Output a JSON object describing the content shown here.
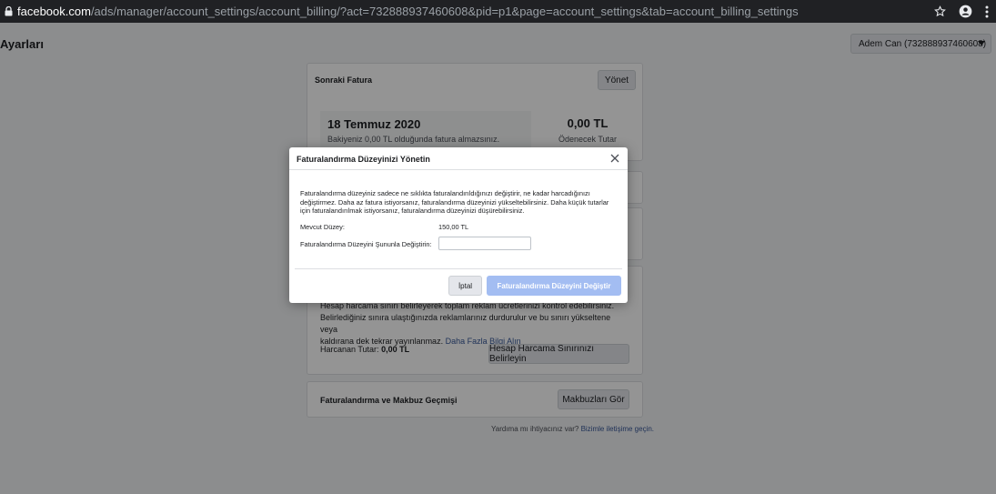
{
  "browser": {
    "url_domain": "facebook.com",
    "url_path": "/ads/manager/account_settings/account_billing/?act=732888937460608&pid=p1&page=account_settings&tab=account_billing_settings"
  },
  "header": {
    "title": "Ayarları",
    "account_selector": "Adem Can (732888937460608)"
  },
  "next_invoice": {
    "title": "Sonraki Fatura",
    "manage_button": "Yönet",
    "date": "18 Temmuz 2020",
    "note": "Bakiyeniz 0,00 TL olduğunda fatura almazsınız.",
    "amount": "0,00 TL",
    "amount_label": "Ödenecek Tutar"
  },
  "spending_limit": {
    "text_line1": "Hesap harcama sınırı belirleyerek toplam reklam ücretlerinizi kontrol edebilirsiniz.",
    "text_line2": "Belirlediğiniz sınıra ulaştığınızda reklamlarınız durdurulur ve bu sınırı yükseltene veya",
    "text_line3": "kaldırana dek tekrar yayınlanmaz.",
    "learn_more": "Daha Fazla Bilgi Alın",
    "spent_label": "Harcanan Tutar:",
    "spent_value": "0,00 TL",
    "set_limit_button": "Hesap Harcama Sınırınızı Belirleyin"
  },
  "history": {
    "title": "Faturalandırma ve Makbuz Geçmişi",
    "view_button": "Makbuzları Gör"
  },
  "footer": {
    "help_text": "Yardıma mı ihtiyacınız var?",
    "contact_link": "Bizimle iletişime geçin."
  },
  "modal": {
    "title": "Faturalandırma Düzeyinizi Yönetin",
    "desc_line1": "Faturalandırma düzeyiniz sadece ne sıklıkta faturalandırıldığınızı değiştirir, ne kadar harcadığınızı",
    "desc_line2": "değiştirmez. Daha az fatura istiyorsanız, faturalandırma düzeyinizi yükseltebilirsiniz. Daha küçük tutarlar",
    "desc_line3": "için faturalandırılmak istiyorsanız, faturalandırma düzeyinizi düşürebilirsiniz.",
    "current_level_label": "Mevcut Düzey:",
    "current_level_value": "150,00 TL",
    "change_label": "Faturalandırma Düzeyini Şununla Değiştirin:",
    "change_input_value": "",
    "cancel_button": "İptal",
    "confirm_button": "Faturalandırma Düzeyini Değiştir"
  },
  "colors": {
    "primary_disabled": "#a3bdf2",
    "link": "#385898"
  },
  "icons": {
    "lock": "lock-icon",
    "star": "star-icon",
    "profile": "account-circle-icon",
    "menu": "more-vert-icon",
    "close": "close-icon",
    "dropdown": "caret-down-icon"
  }
}
